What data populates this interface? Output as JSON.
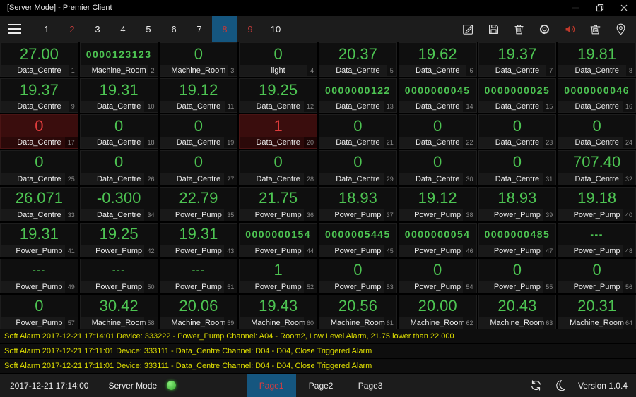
{
  "window": {
    "title": "[Server Mode] - Premier Client",
    "control_icons": [
      "minimize-icon",
      "maximize-icon",
      "close-icon"
    ]
  },
  "toolbar": {
    "menu_icon": "hamburger-menu-icon",
    "pages": [
      {
        "label": "1",
        "alert": false,
        "selected": false
      },
      {
        "label": "2",
        "alert": true,
        "selected": false
      },
      {
        "label": "3",
        "alert": false,
        "selected": false
      },
      {
        "label": "4",
        "alert": false,
        "selected": false
      },
      {
        "label": "5",
        "alert": false,
        "selected": false
      },
      {
        "label": "6",
        "alert": false,
        "selected": false
      },
      {
        "label": "7",
        "alert": false,
        "selected": false
      },
      {
        "label": "8",
        "alert": true,
        "selected": true
      },
      {
        "label": "9",
        "alert": true,
        "selected": false
      },
      {
        "label": "10",
        "alert": false,
        "selected": false
      }
    ],
    "icon_names": [
      "edit-icon",
      "save-icon",
      "delete-icon",
      "settings-icon",
      "sound-on-icon",
      "clear-bin-icon",
      "location-pin-icon"
    ]
  },
  "grid": {
    "cells": [
      {
        "value": "27.00",
        "label": "Data_Centre",
        "index": "1",
        "alarm": false,
        "small": false
      },
      {
        "value": "0000123123",
        "label": "Machine_Room",
        "index": "2",
        "alarm": false,
        "small": true
      },
      {
        "value": "0",
        "label": "Machine_Room",
        "index": "3",
        "alarm": false,
        "small": false
      },
      {
        "value": "0",
        "label": "light",
        "index": "4",
        "alarm": false,
        "small": false
      },
      {
        "value": "20.37",
        "label": "Data_Centre",
        "index": "5",
        "alarm": false,
        "small": false
      },
      {
        "value": "19.62",
        "label": "Data_Centre",
        "index": "6",
        "alarm": false,
        "small": false
      },
      {
        "value": "19.37",
        "label": "Data_Centre",
        "index": "7",
        "alarm": false,
        "small": false
      },
      {
        "value": "19.81",
        "label": "Data_Centre",
        "index": "8",
        "alarm": false,
        "small": false
      },
      {
        "value": "19.37",
        "label": "Data_Centre",
        "index": "9",
        "alarm": false,
        "small": false
      },
      {
        "value": "19.31",
        "label": "Data_Centre",
        "index": "10",
        "alarm": false,
        "small": false
      },
      {
        "value": "19.12",
        "label": "Data_Centre",
        "index": "11",
        "alarm": false,
        "small": false
      },
      {
        "value": "19.25",
        "label": "Data_Centre",
        "index": "12",
        "alarm": false,
        "small": false
      },
      {
        "value": "0000000122",
        "label": "Data_Centre",
        "index": "13",
        "alarm": false,
        "small": true
      },
      {
        "value": "0000000045",
        "label": "Data_Centre",
        "index": "14",
        "alarm": false,
        "small": true
      },
      {
        "value": "0000000025",
        "label": "Data_Centre",
        "index": "15",
        "alarm": false,
        "small": true
      },
      {
        "value": "0000000046",
        "label": "Data_Centre",
        "index": "16",
        "alarm": false,
        "small": true
      },
      {
        "value": "0",
        "label": "Data_Centre",
        "index": "17",
        "alarm": true,
        "small": false
      },
      {
        "value": "0",
        "label": "Data_Centre",
        "index": "18",
        "alarm": false,
        "small": false
      },
      {
        "value": "0",
        "label": "Data_Centre",
        "index": "19",
        "alarm": false,
        "small": false
      },
      {
        "value": "1",
        "label": "Data_Centre",
        "index": "20",
        "alarm": true,
        "small": false
      },
      {
        "value": "0",
        "label": "Data_Centre",
        "index": "21",
        "alarm": false,
        "small": false
      },
      {
        "value": "0",
        "label": "Data_Centre",
        "index": "22",
        "alarm": false,
        "small": false
      },
      {
        "value": "0",
        "label": "Data_Centre",
        "index": "23",
        "alarm": false,
        "small": false
      },
      {
        "value": "0",
        "label": "Data_Centre",
        "index": "24",
        "alarm": false,
        "small": false
      },
      {
        "value": "0",
        "label": "Data_Centre",
        "index": "25",
        "alarm": false,
        "small": false
      },
      {
        "value": "0",
        "label": "Data_Centre",
        "index": "26",
        "alarm": false,
        "small": false
      },
      {
        "value": "0",
        "label": "Data_Centre",
        "index": "27",
        "alarm": false,
        "small": false
      },
      {
        "value": "0",
        "label": "Data_Centre",
        "index": "28",
        "alarm": false,
        "small": false
      },
      {
        "value": "0",
        "label": "Data_Centre",
        "index": "29",
        "alarm": false,
        "small": false
      },
      {
        "value": "0",
        "label": "Data_Centre",
        "index": "30",
        "alarm": false,
        "small": false
      },
      {
        "value": "0",
        "label": "Data_Centre",
        "index": "31",
        "alarm": false,
        "small": false
      },
      {
        "value": "707.40",
        "label": "Data_Centre",
        "index": "32",
        "alarm": false,
        "small": false
      },
      {
        "value": "26.071",
        "label": "Data_Centre",
        "index": "33",
        "alarm": false,
        "small": false
      },
      {
        "value": "-0.300",
        "label": "Data_Centre",
        "index": "34",
        "alarm": false,
        "small": false
      },
      {
        "value": "22.79",
        "label": "Power_Pump",
        "index": "35",
        "alarm": false,
        "small": false
      },
      {
        "value": "21.75",
        "label": "Power_Pump",
        "index": "36",
        "alarm": false,
        "small": false
      },
      {
        "value": "18.93",
        "label": "Power_Pump",
        "index": "37",
        "alarm": false,
        "small": false
      },
      {
        "value": "19.12",
        "label": "Power_Pump",
        "index": "38",
        "alarm": false,
        "small": false
      },
      {
        "value": "18.93",
        "label": "Power_Pump",
        "index": "39",
        "alarm": false,
        "small": false
      },
      {
        "value": "19.18",
        "label": "Power_Pump",
        "index": "40",
        "alarm": false,
        "small": false
      },
      {
        "value": "19.31",
        "label": "Power_Pump",
        "index": "41",
        "alarm": false,
        "small": false
      },
      {
        "value": "19.25",
        "label": "Power_Pump",
        "index": "42",
        "alarm": false,
        "small": false
      },
      {
        "value": "19.31",
        "label": "Power_Pump",
        "index": "43",
        "alarm": false,
        "small": false
      },
      {
        "value": "0000000154",
        "label": "Power_Pump",
        "index": "44",
        "alarm": false,
        "small": true
      },
      {
        "value": "0000005445",
        "label": "Power_Pump",
        "index": "45",
        "alarm": false,
        "small": true
      },
      {
        "value": "0000000054",
        "label": "Power_Pump",
        "index": "46",
        "alarm": false,
        "small": true
      },
      {
        "value": "0000000485",
        "label": "Power_Pump",
        "index": "47",
        "alarm": false,
        "small": true
      },
      {
        "value": "---",
        "label": "Power_Pump",
        "index": "48",
        "alarm": false,
        "small": true
      },
      {
        "value": "---",
        "label": "Power_Pump",
        "index": "49",
        "alarm": false,
        "small": true
      },
      {
        "value": "---",
        "label": "Power_Pump",
        "index": "50",
        "alarm": false,
        "small": true
      },
      {
        "value": "---",
        "label": "Power_Pump",
        "index": "51",
        "alarm": false,
        "small": true
      },
      {
        "value": "1",
        "label": "Power_Pump",
        "index": "52",
        "alarm": false,
        "small": false
      },
      {
        "value": "0",
        "label": "Power_Pump",
        "index": "53",
        "alarm": false,
        "small": false
      },
      {
        "value": "0",
        "label": "Power_Pump",
        "index": "54",
        "alarm": false,
        "small": false
      },
      {
        "value": "0",
        "label": "Power_Pump",
        "index": "55",
        "alarm": false,
        "small": false
      },
      {
        "value": "0",
        "label": "Power_Pump",
        "index": "56",
        "alarm": false,
        "small": false
      },
      {
        "value": "0",
        "label": "Power_Pump",
        "index": "57",
        "alarm": false,
        "small": false
      },
      {
        "value": "30.42",
        "label": "Machine_Room",
        "index": "58",
        "alarm": false,
        "small": false
      },
      {
        "value": "20.06",
        "label": "Machine_Room",
        "index": "59",
        "alarm": false,
        "small": false
      },
      {
        "value": "19.43",
        "label": "Machine_Room",
        "index": "60",
        "alarm": false,
        "small": false
      },
      {
        "value": "20.56",
        "label": "Machine_Room",
        "index": "61",
        "alarm": false,
        "small": false
      },
      {
        "value": "20.00",
        "label": "Machine_Room",
        "index": "62",
        "alarm": false,
        "small": false
      },
      {
        "value": "20.43",
        "label": "Machine_Room",
        "index": "63",
        "alarm": false,
        "small": false
      },
      {
        "value": "20.31",
        "label": "Machine_Room",
        "index": "64",
        "alarm": false,
        "small": false
      }
    ]
  },
  "alarms": [
    "Soft Alarm 2017-12-21 17:14:01 Device: 333222 - Power_Pump Channel: A04 - Room2, Low Level Alarm, 21.75 lower than 22.000",
    "Soft Alarm 2017-12-21 17:11:01 Device: 333111 - Data_Centre Channel: D04 - D04, Close Triggered Alarm",
    "Soft Alarm 2017-12-21 17:11:01 Device: 333111 - Data_Centre Channel: D04 - D04, Close Triggered Alarm"
  ],
  "statusbar": {
    "timestamp": "2017-12-21 17:14:00",
    "mode_label": "Server Mode",
    "mode_indicator": "green-led",
    "tabs": [
      {
        "label": "Page1",
        "selected": true
      },
      {
        "label": "Page2",
        "selected": false
      },
      {
        "label": "Page3",
        "selected": false
      }
    ],
    "icon_names": [
      "sync-icon",
      "night-mode-icon"
    ],
    "version": "Version 1.0.4"
  },
  "colors": {
    "value_green": "#4DC452",
    "alarm_red": "#E03C3C",
    "alarm_cell_bg": "#3A0D0D",
    "selected_blue": "#15567F",
    "alarm_text": "#DFDF00",
    "toolbar_red": "#BE3A3A",
    "led_green": "#2FA328"
  }
}
